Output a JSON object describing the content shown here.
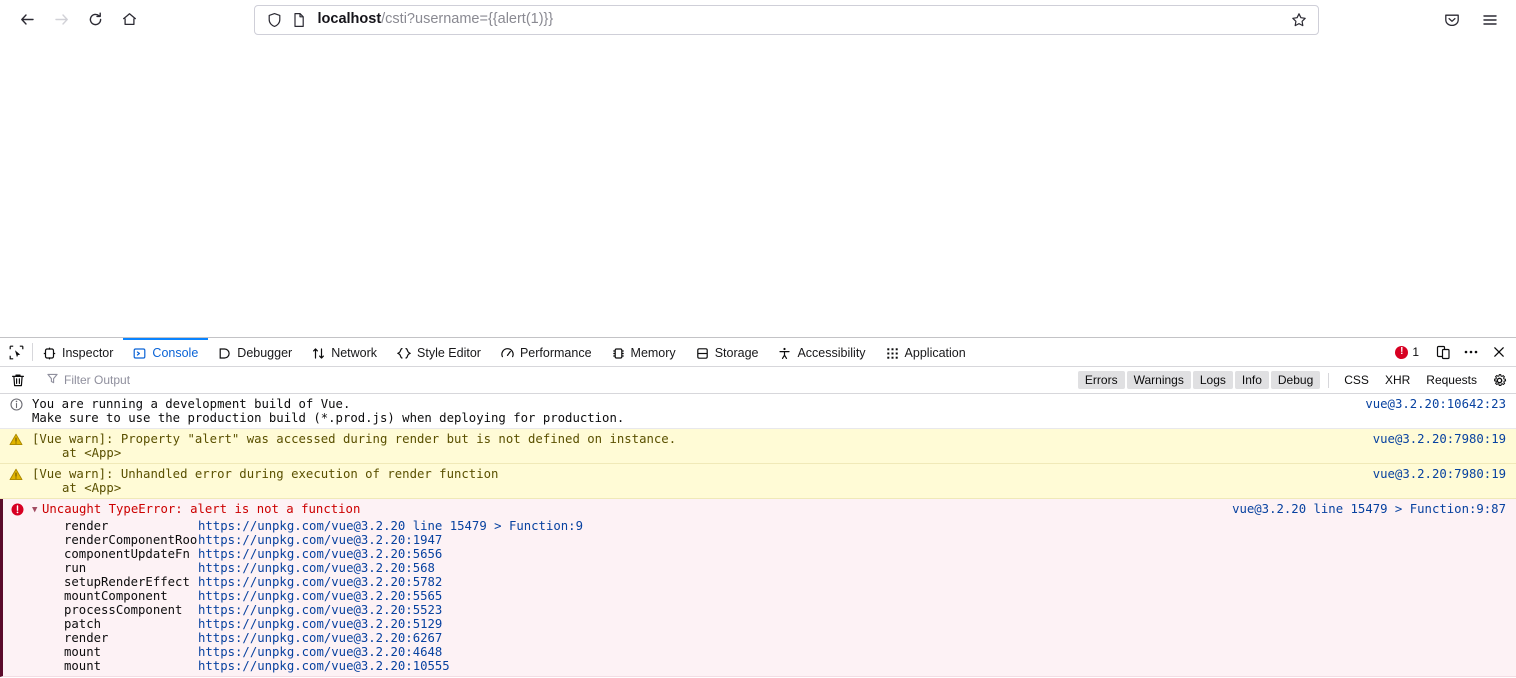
{
  "browser": {
    "nav": {
      "back_label": "Back",
      "forward_label": "Forward",
      "reload_label": "Reload",
      "home_label": "Home"
    },
    "urlbar": {
      "shield_icon": "shield-icon",
      "page_icon": "page-icon",
      "url_host": "localhost",
      "url_path": "/csti?username={{alert(1)}}",
      "full_url": "localhost/csti?username={{alert(1)}}",
      "bookmark_icon": "star-icon"
    },
    "right_icons": [
      {
        "name": "pocket-icon",
        "label": "Save to Pocket"
      },
      {
        "name": "app-menu-icon",
        "label": "Open application menu"
      }
    ]
  },
  "devtools": {
    "picker_icon": "element-picker-icon",
    "tabs": [
      {
        "label": "Inspector",
        "icon": "inspector-icon",
        "active": false
      },
      {
        "label": "Console",
        "icon": "console-icon",
        "active": true
      },
      {
        "label": "Debugger",
        "icon": "debugger-icon",
        "active": false
      },
      {
        "label": "Network",
        "icon": "network-icon",
        "active": false
      },
      {
        "label": "Style Editor",
        "icon": "style-editor-icon",
        "active": false
      },
      {
        "label": "Performance",
        "icon": "performance-icon",
        "active": false
      },
      {
        "label": "Memory",
        "icon": "memory-icon",
        "active": false
      },
      {
        "label": "Storage",
        "icon": "storage-icon",
        "active": false
      },
      {
        "label": "Accessibility",
        "icon": "accessibility-icon",
        "active": false
      },
      {
        "label": "Application",
        "icon": "application-icon",
        "active": false
      }
    ],
    "error_count": "1",
    "toolbar_icons": [
      {
        "name": "responsive-design-mode-icon"
      },
      {
        "name": "devtools-meatball-menu-icon"
      },
      {
        "name": "devtools-close-icon"
      }
    ],
    "filterbar": {
      "clear_icon": "trash-icon",
      "filter_icon": "filter-icon",
      "filter_placeholder": "Filter Output",
      "filter_value": "",
      "toggles": [
        {
          "label": "Errors",
          "on": true
        },
        {
          "label": "Warnings",
          "on": true
        },
        {
          "label": "Logs",
          "on": true
        },
        {
          "label": "Info",
          "on": true
        },
        {
          "label": "Debug",
          "on": true
        }
      ],
      "request_toggles": [
        {
          "label": "CSS",
          "on": false
        },
        {
          "label": "XHR",
          "on": false
        },
        {
          "label": "Requests",
          "on": false
        }
      ],
      "settings_icon": "console-settings-icon"
    },
    "messages": [
      {
        "severity": "info",
        "icon": "info-circle-icon",
        "line1": "You are running a development build of Vue.",
        "line2": "Make sure to use the production build (*.prod.js) when deploying for production.",
        "source": "vue@3.2.20:10642:23"
      },
      {
        "severity": "warn",
        "icon": "warning-triangle-icon",
        "line1": "[Vue warn]: Property \"alert\" was accessed during render but is not defined on instance.",
        "line2": "at <App>",
        "source": "vue@3.2.20:7980:19"
      },
      {
        "severity": "warn",
        "icon": "warning-triangle-icon",
        "line1": "[Vue warn]: Unhandled error during execution of render function",
        "line2": "at <App>",
        "source": "vue@3.2.20:7980:19"
      },
      {
        "severity": "error",
        "icon": "error-circle-icon",
        "twisty": "▼",
        "line1": "Uncaught TypeError: alert is not a function",
        "source": "vue@3.2.20 line 15479 > Function:9:87",
        "stack": [
          {
            "fn": "render",
            "url": "https://unpkg.com/vue@3.2.20 line 15479 > Function:9"
          },
          {
            "fn": "renderComponentRoot",
            "url": "https://unpkg.com/vue@3.2.20:1947"
          },
          {
            "fn": "componentUpdateFn",
            "url": "https://unpkg.com/vue@3.2.20:5656"
          },
          {
            "fn": "run",
            "url": "https://unpkg.com/vue@3.2.20:568"
          },
          {
            "fn": "setupRenderEffect",
            "url": "https://unpkg.com/vue@3.2.20:5782"
          },
          {
            "fn": "mountComponent",
            "url": "https://unpkg.com/vue@3.2.20:5565"
          },
          {
            "fn": "processComponent",
            "url": "https://unpkg.com/vue@3.2.20:5523"
          },
          {
            "fn": "patch",
            "url": "https://unpkg.com/vue@3.2.20:5129"
          },
          {
            "fn": "render",
            "url": "https://unpkg.com/vue@3.2.20:6267"
          },
          {
            "fn": "mount",
            "url": "https://unpkg.com/vue@3.2.20:4648"
          },
          {
            "fn": "mount",
            "url": "https://unpkg.com/vue@3.2.20:10555"
          }
        ]
      }
    ]
  },
  "colors": {
    "accent": "#0a84ff",
    "error": "#d70022",
    "warn_bg": "#fffbd6",
    "error_bg": "#fdf2f5",
    "link": "#0842a0"
  }
}
